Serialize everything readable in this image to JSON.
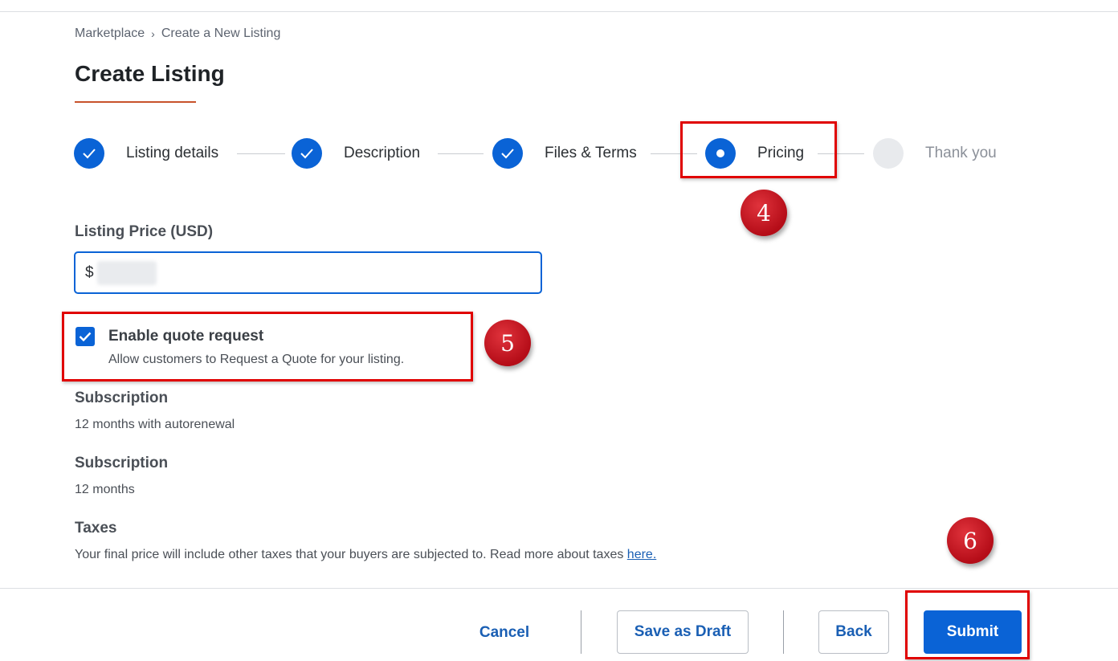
{
  "breadcrumb": {
    "items": [
      "Marketplace",
      "Create a New Listing"
    ],
    "separator": "›"
  },
  "page": {
    "title": "Create Listing"
  },
  "stepper": {
    "steps": [
      {
        "label": "Listing details",
        "state": "done"
      },
      {
        "label": "Description",
        "state": "done"
      },
      {
        "label": "Files & Terms",
        "state": "done"
      },
      {
        "label": "Pricing",
        "state": "active"
      },
      {
        "label": "Thank you",
        "state": "pending"
      }
    ]
  },
  "annotations": {
    "badge_4": "4",
    "badge_5": "5",
    "badge_6": "6",
    "highlight_color": "#e00000",
    "badge_color": "#c1121f"
  },
  "pricing": {
    "price_label": "Listing Price (USD)",
    "currency_symbol": "$",
    "price_value_redacted": true
  },
  "quote": {
    "checked": true,
    "title": "Enable quote request",
    "description": "Allow customers to Request a Quote for your listing."
  },
  "subscriptions": [
    {
      "title": "Subscription",
      "value": "12 months with autorenewal"
    },
    {
      "title": "Subscription",
      "value": "12 months"
    }
  ],
  "taxes": {
    "title": "Taxes",
    "text": "Your final price will include other taxes that your buyers are subjected to. Read more about taxes ",
    "link_label": "here."
  },
  "footer": {
    "cancel_label": "Cancel",
    "draft_label": "Save as Draft",
    "back_label": "Back",
    "submit_label": "Submit"
  },
  "colors": {
    "primary": "#0a63d6",
    "accent_underline": "#c8522b",
    "link": "#1a5fb4"
  }
}
